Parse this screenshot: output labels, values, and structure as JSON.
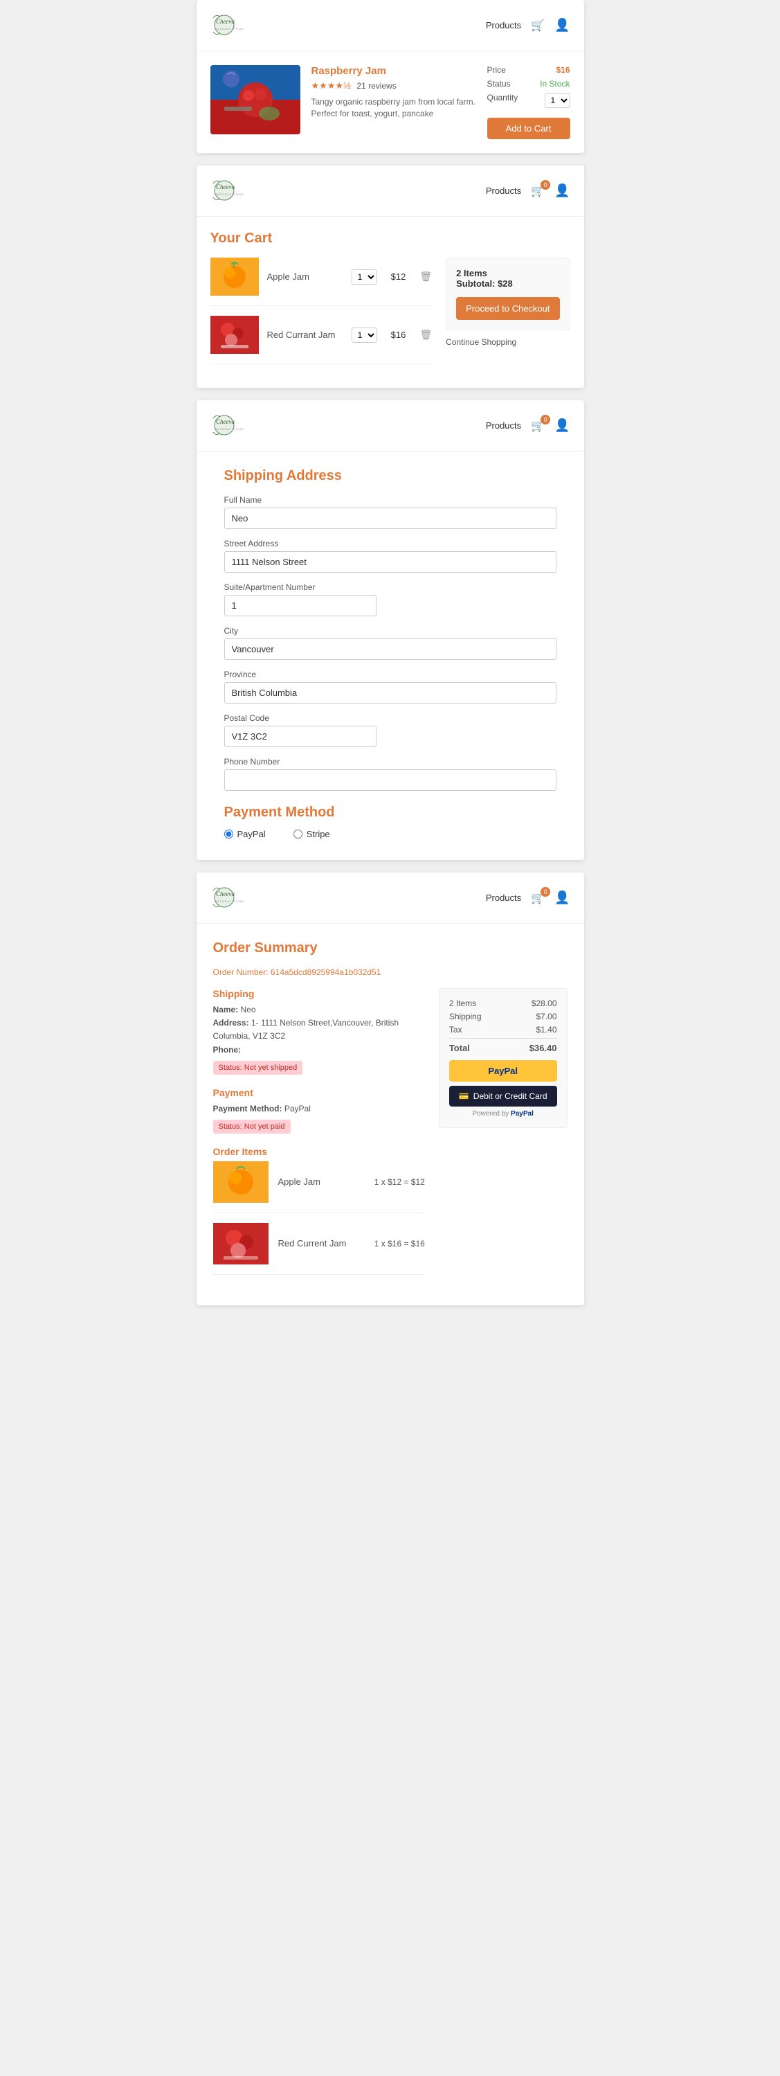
{
  "brand": {
    "name": "Cheeva",
    "subtitle": "NATURAL FOOD",
    "color": "#5a8a5a"
  },
  "nav": {
    "products_label": "Products"
  },
  "screen1": {
    "product": {
      "name": "Raspberry Jam",
      "stars": "★★★★½",
      "reviews": "21 reviews",
      "description": "Tangy organic raspberry jam from local farm. Perfect for toast, yogurt, pancake",
      "price_label": "Price",
      "price_value": "$16",
      "status_label": "Status",
      "status_value": "In Stock",
      "quantity_label": "Quantity",
      "quantity_value": "1",
      "add_to_cart": "Add to Cart"
    }
  },
  "screen2": {
    "title": "Your Cart",
    "items": [
      {
        "name": "Apple Jam",
        "qty": "1",
        "price": "$12",
        "type": "apple"
      },
      {
        "name": "Red Currant Jam",
        "qty": "1",
        "price": "$16",
        "type": "redcurrant"
      }
    ],
    "summary": {
      "items_count": "2 Items",
      "subtotal_label": "Subtotal:",
      "subtotal_value": "$28",
      "checkout_label": "Proceed to Checkout",
      "continue_label": "Continue Shopping"
    },
    "cart_count": "0"
  },
  "screen3": {
    "title": "Shipping Address",
    "fields": {
      "full_name_label": "Full Name",
      "full_name_value": "Neo",
      "street_label": "Street Address",
      "street_value": "1111 Nelson Street",
      "suite_label": "Suite/Apartment Number",
      "suite_value": "1",
      "city_label": "City",
      "city_value": "Vancouver",
      "province_label": "Province",
      "province_value": "British Columbia",
      "postal_label": "Postal Code",
      "postal_value": "V1Z 3C2",
      "phone_label": "Phone Number",
      "phone_value": ""
    },
    "payment": {
      "title": "Payment Method",
      "paypal_label": "PayPal",
      "stripe_label": "Stripe",
      "selected": "paypal"
    },
    "cart_count": "0"
  },
  "screen4": {
    "title": "Order Summary",
    "order_number_label": "Order Number:",
    "order_number_value": "614a5dcd8925994a1b032d51",
    "shipping": {
      "title": "Shipping",
      "name_label": "Name:",
      "name_value": "Neo",
      "address_label": "Address:",
      "address_value": "1- 1111 Nelson Street,Vancouver, British Columbia, V1Z 3C2",
      "phone_label": "Phone:",
      "phone_value": "",
      "status": "Status: Not yet shipped"
    },
    "payment": {
      "title": "Payment",
      "method_label": "Payment Method:",
      "method_value": "PayPal",
      "status": "Status: Not yet paid"
    },
    "order_items_title": "Order Items",
    "items": [
      {
        "name": "Apple Jam",
        "calc": "1 x $12 = $12",
        "type": "apple"
      },
      {
        "name": "Red Current Jam",
        "calc": "1 x $16 = $16",
        "type": "redcurrant"
      }
    ],
    "price_summary": {
      "items_label": "2 Items",
      "items_value": "$28.00",
      "shipping_label": "Shipping",
      "shipping_value": "$7.00",
      "tax_label": "Tax",
      "tax_value": "$1.40",
      "total_label": "Total",
      "total_value": "$36.40"
    },
    "paypal_btn": "PayPal",
    "debit_btn": "Debit or Credit Card",
    "powered_label": "Powered by",
    "powered_brand": "PayPal",
    "cart_count": "0"
  }
}
